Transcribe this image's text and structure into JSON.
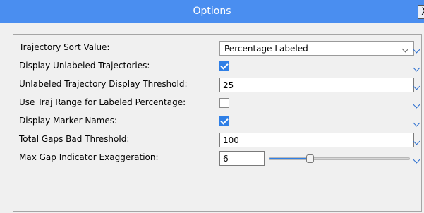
{
  "window": {
    "title": "Options",
    "close_label": "X"
  },
  "options": {
    "sort": {
      "label": "Trajectory Sort Value:",
      "value": "Percentage Labeled"
    },
    "display_unlabeled": {
      "label": "Display Unlabeled Trajectories:",
      "checked": true
    },
    "unlabeled_threshold": {
      "label": "Unlabeled Trajectory Display Threshold:",
      "value": "25"
    },
    "use_traj_range": {
      "label": "Use Traj Range for Labeled Percentage:",
      "checked": false
    },
    "display_marker_names": {
      "label": "Display Marker Names:",
      "checked": true
    },
    "total_gaps": {
      "label": "Total Gaps Bad Threshold:",
      "value": "100"
    },
    "max_gap": {
      "label": "Max Gap Indicator Exaggeration:",
      "value": "6",
      "slider_fraction": 0.28
    }
  },
  "colors": {
    "titlebar": "#4a8ef0",
    "accent": "#2f7fe6"
  },
  "icons": {
    "dropdown": "chevron-down-icon",
    "expand": "chevron-down-icon",
    "close": "close-icon"
  }
}
